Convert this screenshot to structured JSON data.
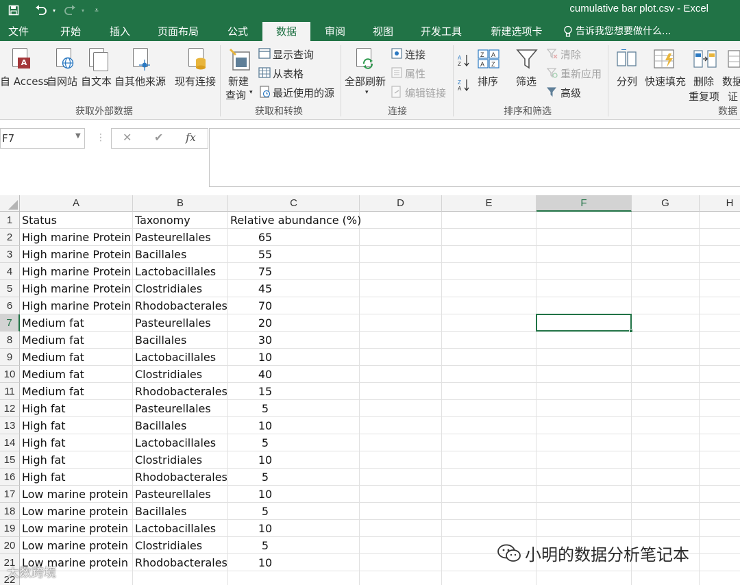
{
  "window": {
    "title": "cumulative bar plot.csv - Excel"
  },
  "tabs": [
    "文件",
    "开始",
    "插入",
    "页面布局",
    "公式",
    "数据",
    "审阅",
    "视图",
    "开发工具",
    "新建选项卡"
  ],
  "active_tab": "数据",
  "tell_me": "告诉我您想要做什么...",
  "ribbon": {
    "get_external": {
      "access": "自 Access",
      "web": "自网站",
      "text": "自文本",
      "other": "自其他来源",
      "existing": "现有连接",
      "label": "获取外部数据"
    },
    "transform": {
      "new_query_1": "新建",
      "new_query_2": "查询",
      "show_queries": "显示查询",
      "from_table": "从表格",
      "recent": "最近使用的源",
      "label": "获取和转换"
    },
    "connections": {
      "refresh_all": "全部刷新",
      "connections": "连接",
      "properties": "属性",
      "edit_links": "编辑链接",
      "label": "连接"
    },
    "sort_filter": {
      "sort": "排序",
      "filter": "筛选",
      "clear": "清除",
      "reapply": "重新应用",
      "advanced": "高级",
      "label": "排序和筛选"
    },
    "data_tools": {
      "split": "分列",
      "flash_fill": "快速填充",
      "remove_dup_1": "删除",
      "remove_dup_2": "重复项",
      "validation_1": "数据",
      "validation_2": "证",
      "label": "数据"
    }
  },
  "formula_bar": {
    "name_box": "F7",
    "fx": "fx",
    "cancel": "✕",
    "enter": "✔",
    "formula": ""
  },
  "columns": [
    "A",
    "B",
    "C",
    "D",
    "E",
    "F",
    "G",
    "H"
  ],
  "selected_column": "F",
  "selected_row": "7",
  "rows": [
    {
      "num": "1",
      "a": "Status",
      "b": "Taxonomy",
      "c": "Relative abundance (%)"
    },
    {
      "num": "2",
      "a": "High marine Protein",
      "b": "Pasteurellales",
      "c": "65"
    },
    {
      "num": "3",
      "a": "High marine Protein",
      "b": "Bacillales",
      "c": "55"
    },
    {
      "num": "4",
      "a": "High marine Protein",
      "b": "Lactobacillales",
      "c": "75"
    },
    {
      "num": "5",
      "a": "High marine Protein",
      "b": "Clostridiales",
      "c": "45"
    },
    {
      "num": "6",
      "a": "High marine Protein",
      "b": "Rhodobacterales",
      "c": "70"
    },
    {
      "num": "7",
      "a": "Medium fat",
      "b": "Pasteurellales",
      "c": "20"
    },
    {
      "num": "8",
      "a": "Medium fat",
      "b": "Bacillales",
      "c": "30"
    },
    {
      "num": "9",
      "a": "Medium fat",
      "b": "Lactobacillales",
      "c": "10"
    },
    {
      "num": "10",
      "a": "Medium fat",
      "b": "Clostridiales",
      "c": "40"
    },
    {
      "num": "11",
      "a": "Medium fat",
      "b": "Rhodobacterales",
      "c": "15"
    },
    {
      "num": "12",
      "a": "High fat",
      "b": "Pasteurellales",
      "c": "5"
    },
    {
      "num": "13",
      "a": "High fat",
      "b": "Bacillales",
      "c": "10"
    },
    {
      "num": "14",
      "a": "High fat",
      "b": "Lactobacillales",
      "c": "5"
    },
    {
      "num": "15",
      "a": "High fat",
      "b": "Clostridiales",
      "c": "10"
    },
    {
      "num": "16",
      "a": "High fat",
      "b": "Rhodobacterales",
      "c": "5"
    },
    {
      "num": "17",
      "a": "Low marine protein",
      "b": "Pasteurellales",
      "c": "10"
    },
    {
      "num": "18",
      "a": "Low marine protein",
      "b": "Bacillales",
      "c": "5"
    },
    {
      "num": "19",
      "a": "Low marine protein",
      "b": "Lactobacillales",
      "c": "10"
    },
    {
      "num": "20",
      "a": "Low marine protein",
      "b": "Clostridiales",
      "c": "5"
    },
    {
      "num": "21",
      "a": "Low marine protein",
      "b": "Rhodobacterales",
      "c": "10"
    },
    {
      "num": "22",
      "a": "",
      "b": "",
      "c": ""
    }
  ],
  "watermark": "小明的数据分析笔记本",
  "watermark2": "大数跨境",
  "colors": {
    "accent": "#217346",
    "ribbon_bg": "#f3f3f3",
    "header_bg": "#f3f3f3"
  }
}
